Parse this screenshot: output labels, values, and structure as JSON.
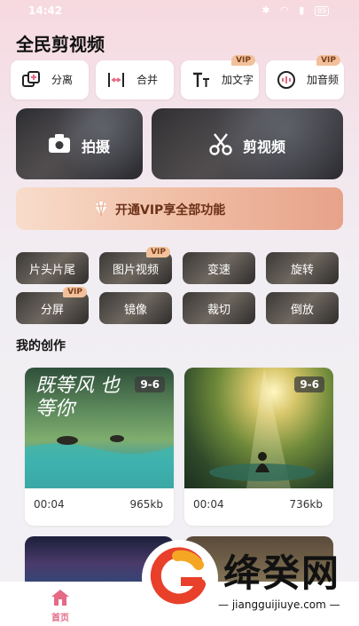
{
  "status_bar": {
    "time": "14:42",
    "battery": "89"
  },
  "app_title": "全民剪视频",
  "tools": [
    {
      "label": "分离",
      "icon": "split-icon",
      "vip": ""
    },
    {
      "label": "合并",
      "icon": "merge-icon",
      "vip": ""
    },
    {
      "label": "加文字",
      "icon": "text-icon",
      "vip": "VIP"
    },
    {
      "label": "加音频",
      "icon": "audio-icon",
      "vip": "VIP"
    }
  ],
  "big_actions": [
    {
      "label": "拍摄",
      "icon": "camera-icon"
    },
    {
      "label": "剪视频",
      "icon": "scissors-icon"
    }
  ],
  "vip_banner": {
    "label": "开通VIP享全部功能",
    "icon": "diamond-icon"
  },
  "chips": [
    {
      "label": "片头片尾",
      "vip": ""
    },
    {
      "label": "图片视频",
      "vip": "VIP"
    },
    {
      "label": "变速",
      "vip": ""
    },
    {
      "label": "旋转",
      "vip": ""
    },
    {
      "label": "分屏",
      "vip": "VIP"
    },
    {
      "label": "镜像",
      "vip": ""
    },
    {
      "label": "裁切",
      "vip": ""
    },
    {
      "label": "倒放",
      "vip": ""
    }
  ],
  "section_title": "我的创作",
  "works": [
    {
      "date": "9-6",
      "duration": "00:04",
      "size": "965kb",
      "overlay_text": "既等风 也等你"
    },
    {
      "date": "9-6",
      "duration": "00:04",
      "size": "736kb"
    },
    {
      "date": "",
      "duration": "",
      "size": ""
    },
    {
      "date": "",
      "duration": "",
      "size": ""
    }
  ],
  "tabbar": {
    "home_label": "首页",
    "icon": "home-icon"
  },
  "watermark": {
    "text": "绛癸网",
    "url": "jiangguijiuye.com"
  },
  "colors": {
    "accent": "#e46a86",
    "vip_tag": "#f2c19b",
    "banner_text": "#6b3118"
  }
}
